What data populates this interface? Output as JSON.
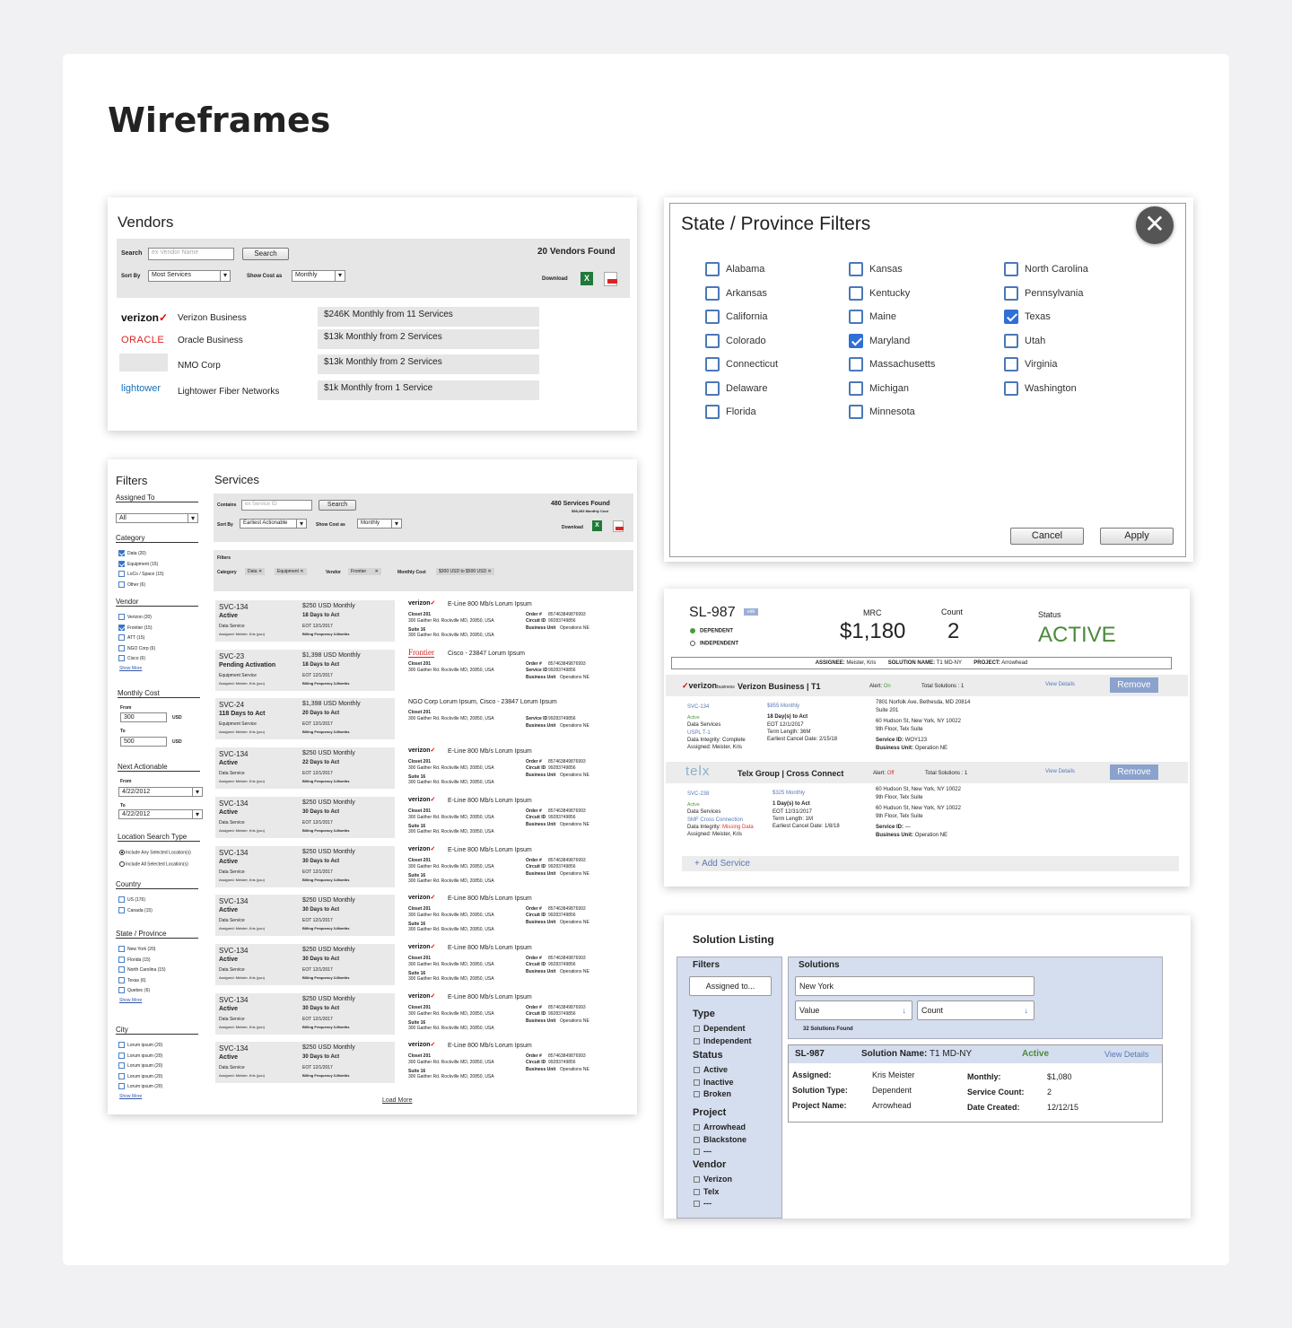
{
  "page": {
    "title": "Wireframes"
  },
  "vendors": {
    "title": "Vendors",
    "search_label": "Search",
    "search_placeholder": "ex Vendor Name",
    "search_button": "Search",
    "found": "20 Vendors Found",
    "sortby_label": "Sort By",
    "sortby_value": "Most Services",
    "showcost_label": "Show Cost as",
    "showcost_value": "Monthly",
    "download_label": "Download",
    "rows": [
      {
        "logo": "verizon",
        "name": "Verizon Business",
        "summary": "$246K Monthly from 11 Services"
      },
      {
        "logo": "ORACLE",
        "name": "Oracle Business",
        "summary": "$13k Monthly from 2 Services"
      },
      {
        "logo": "",
        "name": "NMO Corp",
        "summary": "$13k Monthly from 2 Services"
      },
      {
        "logo": "lightower",
        "name": "Lightower Fiber Networks",
        "summary": "$1k Monthly from 1 Service"
      }
    ]
  },
  "state_filters": {
    "title": "State / Province Filters",
    "col1": [
      {
        "l": "Alabama",
        "c": false
      },
      {
        "l": "Arkansas",
        "c": false
      },
      {
        "l": "California",
        "c": false
      },
      {
        "l": "Colorado",
        "c": false
      },
      {
        "l": "Connecticut",
        "c": false
      },
      {
        "l": "Delaware",
        "c": false
      },
      {
        "l": "Florida",
        "c": false
      }
    ],
    "col2": [
      {
        "l": "Kansas",
        "c": false
      },
      {
        "l": "Kentucky",
        "c": false
      },
      {
        "l": "Maine",
        "c": false
      },
      {
        "l": "Maryland",
        "c": true
      },
      {
        "l": "Massachusetts",
        "c": false
      },
      {
        "l": "Michigan",
        "c": false
      },
      {
        "l": "Minnesota",
        "c": false
      }
    ],
    "col3": [
      {
        "l": "North Carolina",
        "c": false
      },
      {
        "l": "Pennsylvania",
        "c": false
      },
      {
        "l": "Texas",
        "c": true
      },
      {
        "l": "Utah",
        "c": false
      },
      {
        "l": "Virginia",
        "c": false
      },
      {
        "l": "Washington",
        "c": false
      }
    ],
    "cancel": "Cancel",
    "apply": "Apply"
  },
  "filters": {
    "title": "Filters",
    "assigned_label": "Assigned To",
    "assigned_value": "All",
    "category_label": "Category",
    "category": [
      {
        "l": "Data (20)",
        "c": true
      },
      {
        "l": "Equipment (15)",
        "c": true
      },
      {
        "l": "LoCo / Space (15)",
        "c": false
      },
      {
        "l": "Other (6)",
        "c": false
      }
    ],
    "vendor_label": "Vendor",
    "vendor": [
      {
        "l": "Verizon (20)",
        "c": false
      },
      {
        "l": "Frontier (15)",
        "c": true
      },
      {
        "l": "ATT (15)",
        "c": false
      },
      {
        "l": "NGO Corp (6)",
        "c": false
      },
      {
        "l": "Cisco (6)",
        "c": false
      }
    ],
    "show_more": "Show More",
    "cost_label": "Monthly Cost",
    "from": "From",
    "to": "To",
    "cost_from": "300",
    "cost_to": "500",
    "usd": "USD",
    "next_label": "Next Actionable",
    "date_from": "4/22/2012",
    "date_to": "4/22/2012",
    "loc_label": "Location Search Type",
    "loc_any": "Include Any Selected Location(s)",
    "loc_all": "Include All Selected Location(s)",
    "country_label": "Country",
    "country": [
      {
        "l": "US (176)",
        "c": false
      },
      {
        "l": "Canada (15)",
        "c": false
      }
    ],
    "state_label": "State / Province",
    "state": [
      {
        "l": "New York (20)",
        "c": false
      },
      {
        "l": "Florida (15)",
        "c": false
      },
      {
        "l": "North Carolina (15)",
        "c": false
      },
      {
        "l": "Texas (6)",
        "c": false
      },
      {
        "l": "Quebec (6)",
        "c": false
      }
    ],
    "city_label": "City",
    "city": [
      {
        "l": "Lorum ipsum (20)",
        "c": false
      },
      {
        "l": "Lorum ipsum (20)",
        "c": false
      },
      {
        "l": "Lorum ipsum (20)",
        "c": false
      },
      {
        "l": "Lorum ipsum (20)",
        "c": false
      },
      {
        "l": "Lorum ipsum (20)",
        "c": false
      }
    ]
  },
  "services": {
    "title": "Services",
    "contains_label": "Contains",
    "contains_placeholder": "ex Service ID",
    "search_button": "Search",
    "found": "480 Services Found",
    "found_sub": "$58,283 Monthly Cost",
    "sortby_label": "Sort By",
    "sortby_value": "Earliest Actionable",
    "showcost_label": "Show Cost as",
    "showcost_value": "Monthly",
    "download_label": "Download",
    "filters_label": "Filters",
    "chip_category_label": "Category",
    "chip_data": "Data",
    "chip_equipment": "Equipment",
    "chip_vendor_label": "Vendor",
    "chip_frontier": "Frontier",
    "chip_cost_label": "Monthly Cost",
    "chip_cost": "$300 USD to $500 USD",
    "order_label": "Order #",
    "order_value": "857463849876993",
    "circuit_label": "Circuit ID",
    "circuit_value": "99283749856",
    "service_label": "Service ID",
    "bu_label": "Business Unit",
    "bu_value": "Operations NE",
    "addr_label": "Closet 201",
    "addr_value": "300 Gaither Rd. Rockville MD, 20850, USA",
    "suite_label": "Suite 16",
    "load_more": "Load More",
    "rows": [
      {
        "id": "SVC-134",
        "status": "Active",
        "type": "Data Service",
        "price": "$250 USD Monthly",
        "days": "18 Days to Act",
        "vendor": "verizon",
        "title": "E-Line 800 Mb/s Lorum Ipsum",
        "idl": "Circuit ID"
      },
      {
        "id": "SVC-23",
        "status": "Pending Activation",
        "type": "Equipment Service",
        "price": "$1,398 USD Monthly",
        "days": "18 Days to Act",
        "vendor": "Frontier",
        "title": "Cisco - 23847 Lorum Ipsum",
        "idl": "Service ID"
      },
      {
        "id": "SVC-24",
        "status": "118 Days to Act",
        "type": "Equipment Service",
        "price": "$1,398 USD Monthly",
        "days": "20 Days to Act",
        "vendor": "",
        "title": "NGO Corp Lorum Ipsum, Cisco - 23847 Lorum Ipsum",
        "idl": "Service ID"
      },
      {
        "id": "SVC-134",
        "status": "Active",
        "type": "Data Service",
        "price": "$250 USD Monthly",
        "days": "22 Days to Act",
        "vendor": "verizon",
        "title": "E-Line 800 Mb/s Lorum Ipsum",
        "idl": "Circuit ID"
      },
      {
        "id": "SVC-134",
        "status": "Active",
        "type": "Data Service",
        "price": "$250 USD Monthly",
        "days": "30 Days to Act",
        "vendor": "verizon",
        "title": "E-Line 800 Mb/s Lorum Ipsum",
        "idl": "Circuit ID"
      },
      {
        "id": "SVC-134",
        "status": "Active",
        "type": "Data Service",
        "price": "$250 USD Monthly",
        "days": "30 Days to Act",
        "vendor": "verizon",
        "title": "E-Line 800 Mb/s Lorum Ipsum",
        "idl": "Circuit ID"
      },
      {
        "id": "SVC-134",
        "status": "Active",
        "type": "Data Service",
        "price": "$250 USD Monthly",
        "days": "30 Days to Act",
        "vendor": "verizon",
        "title": "E-Line 800 Mb/s Lorum Ipsum",
        "idl": "Circuit ID"
      },
      {
        "id": "SVC-134",
        "status": "Active",
        "type": "Data Service",
        "price": "$250 USD Monthly",
        "days": "30 Days to Act",
        "vendor": "verizon",
        "title": "E-Line 800 Mb/s Lorum Ipsum",
        "idl": "Circuit ID"
      },
      {
        "id": "SVC-134",
        "status": "Active",
        "type": "Data Service",
        "price": "$250 USD Monthly",
        "days": "30 Days to Act",
        "vendor": "verizon",
        "title": "E-Line 800 Mb/s Lorum Ipsum",
        "idl": "Circuit ID"
      },
      {
        "id": "SVC-134",
        "status": "Active",
        "type": "Data Service",
        "price": "$250 USD Monthly",
        "days": "30 Days to Act",
        "vendor": "verizon",
        "title": "E-Line 800 Mb/s Lorum Ipsum",
        "idl": "Circuit ID"
      }
    ],
    "assigned_text": "Assigned: Meister, Kris (you)",
    "eot": "EOT 12/1/2017",
    "billing": "Billing Frequency 3-Months"
  },
  "solution_detail": {
    "id": "SL-987",
    "edit": "edit",
    "dependent": "DEPENDENT",
    "independent": "INDEPENDENT",
    "mrc_label": "MRC",
    "mrc": "$1,180",
    "count_label": "Count",
    "count": "2",
    "status_label": "Status",
    "status": "ACTIVE",
    "assignee_label": "ASSIGNEE:",
    "assignee": "Meister, Kris",
    "solname_label": "SOLUTION NAME:",
    "solname": "T1 MD-NY",
    "project_label": "PROJECT:",
    "project": "Arrowhead",
    "vendors": [
      {
        "logo": "verizon",
        "logo_sub": "business",
        "name": "Verizon Business | T1",
        "alert_label": "Alert:",
        "alert": "On",
        "total": "Total Solutions : 1",
        "view": "View Details",
        "remove": "Remove",
        "svc": "SVC-134",
        "status": "Active",
        "type": "Data Services",
        "circuit": "USPL T-1",
        "integ_label": "Data Integrity:",
        "integ": "Complete",
        "assigned": "Assigned: Meister, Kris",
        "price": "$855 Monthly",
        "days": "18 Day(s) to Act",
        "eot": "EOT 12/1/2017",
        "term": "Term Length: 36M",
        "cancel": "Earliest Cancel Date: 2/15/18",
        "addr1": "7801 Norfolk Ave, Bethesda, MD 20814",
        "addr2": "Suite 201",
        "addr3": "60 Hudson St, New York, NY 10022",
        "addr4": "9th Floor, Telx Suite",
        "sid_label": "Service ID:",
        "sid": "WOY123",
        "bu_label": "Business Unit:",
        "bu": "Operation NE"
      },
      {
        "logo": "telx",
        "logo_sub": "",
        "name": "Telx Group | Cross Connect",
        "alert_label": "Alert:",
        "alert": "Off",
        "total": "Total Solutions : 1",
        "view": "View Details",
        "remove": "Remove",
        "svc": "SVC-238",
        "status": "Active",
        "type": "Data Services",
        "circuit": "SMF Cross Connection",
        "integ_label": "Data Integrity:",
        "integ": "Missing Data",
        "assigned": "Assigned: Meister, Kris",
        "price": "$325 Monthly",
        "days": "1 Day(s) to Act",
        "eot": "EOT 12/31/2017",
        "term": "Term Length: 1M",
        "cancel": "Earliest Cancel Date: 1/8/18",
        "addr1": "60 Hudson St, New York, NY 10022",
        "addr2": "9th Floor, Telx Suite",
        "addr3": "60 Hudson St, New York, NY 10022",
        "addr4": "9th Floor, Telx Suite",
        "sid_label": "Service ID:",
        "sid": "—",
        "bu_label": "Business Unit:",
        "bu": "Operation NE"
      }
    ],
    "add_service": "+ Add Service"
  },
  "solution_listing": {
    "title": "Solution Listing",
    "filters": "Filters",
    "assigned_button": "Assigned to...",
    "type_label": "Type",
    "types": [
      "Dependent",
      "Independent"
    ],
    "status_label": "Status",
    "statuses": [
      "Active",
      "Inactive",
      "Broken"
    ],
    "project_label": "Project",
    "projects": [
      "Arrowhead",
      "Blackstone",
      "---"
    ],
    "vendor_label": "Vendor",
    "vendors_list": [
      "Verizon",
      "Telx",
      "---"
    ],
    "solutions_label": "Solutions",
    "search_value": "New York",
    "value_label": "Value",
    "count_label": "Count",
    "found": "32 Solutions Found",
    "row": {
      "id": "SL-987",
      "name_label": "Solution Name:",
      "name": "T1 MD-NY",
      "status": "Active",
      "view": "View Details",
      "assigned_label": "Assigned:",
      "assigned": "Kris Meister",
      "type_label": "Solution Type:",
      "type": "Dependent",
      "project_label": "Project Name:",
      "project": "Arrowhead",
      "monthly_label": "Monthly:",
      "monthly": "$1,080",
      "count_label": "Service Count:",
      "count": "2",
      "date_label": "Date Created:",
      "date": "12/12/15"
    }
  },
  "colors": {
    "accent": "#2f6fd6",
    "active_green": "#4a8a3a",
    "link_blue": "#5778b8",
    "alert_red": "#d33"
  }
}
